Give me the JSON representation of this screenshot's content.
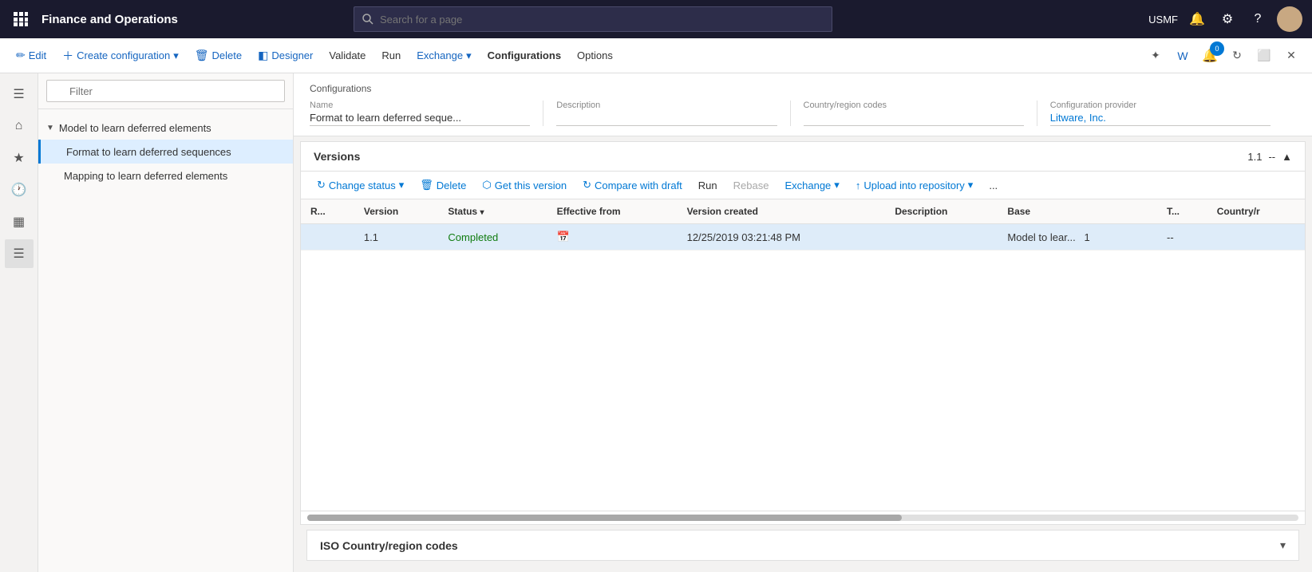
{
  "app": {
    "title": "Finance and Operations"
  },
  "search": {
    "placeholder": "Search for a page"
  },
  "topnav": {
    "user": "USMF"
  },
  "toolbar": {
    "edit_label": "Edit",
    "create_label": "Create configuration",
    "delete_label": "Delete",
    "designer_label": "Designer",
    "validate_label": "Validate",
    "run_label": "Run",
    "exchange_label": "Exchange",
    "configurations_label": "Configurations",
    "options_label": "Options"
  },
  "sidebar": {
    "filter_placeholder": "Filter"
  },
  "tree": {
    "parent_label": "Model to learn deferred elements",
    "child1_label": "Format to learn deferred sequences",
    "child2_label": "Mapping to learn deferred elements"
  },
  "config": {
    "section_label": "Configurations",
    "fields": {
      "name_label": "Name",
      "name_value": "Format to learn deferred seque...",
      "description_label": "Description",
      "description_value": "",
      "country_label": "Country/region codes",
      "country_value": "",
      "provider_label": "Configuration provider",
      "provider_value": "Litware, Inc."
    }
  },
  "versions": {
    "section_label": "Versions",
    "version_number": "1.1",
    "nav_separator": "--",
    "buttons": {
      "change_status": "Change status",
      "delete": "Delete",
      "get_this_version": "Get this version",
      "compare_with_draft": "Compare with draft",
      "run": "Run",
      "rebase": "Rebase",
      "exchange": "Exchange",
      "upload_into_repository": "Upload into repository",
      "more": "..."
    },
    "table": {
      "columns": [
        "R...",
        "Version",
        "Status",
        "Effective from",
        "Version created",
        "Description",
        "Base",
        "T...",
        "Country/r"
      ],
      "rows": [
        {
          "r": "",
          "version": "1.1",
          "status": "Completed",
          "effective_from": "",
          "version_created": "12/25/2019 03:21:48 PM",
          "description": "",
          "base": "Model to lear...",
          "base_version": "1",
          "t": "--",
          "country": ""
        }
      ]
    }
  },
  "iso": {
    "label": "ISO Country/region codes"
  }
}
